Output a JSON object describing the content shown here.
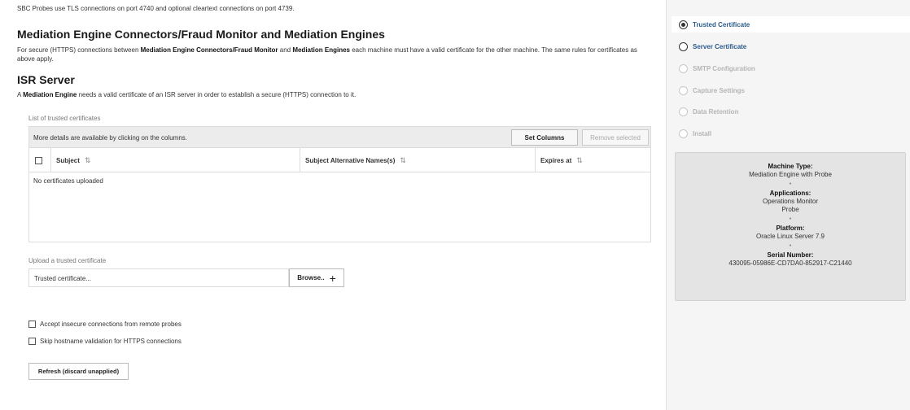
{
  "main": {
    "intro": "SBC Probes use TLS connections on port 4740 and optional cleartext connections on port 4739.",
    "section1": {
      "title": "Mediation Engine Connectors/Fraud Monitor and Mediation Engines",
      "text_1": "For secure (HTTPS) connections between ",
      "bold_1": "Mediation Engine Connectors/Fraud Monitor",
      "text_2": " and ",
      "bold_2": "Mediation Engines",
      "text_3": " each machine must have a valid certificate for the other machine. The same rules for certificates as above apply."
    },
    "section2": {
      "title": "ISR Server",
      "text_1": "A ",
      "bold_1": "Mediation Engine",
      "text_2": " needs a valid certificate of an ISR server in order to establish a secure (HTTPS) connection to it."
    },
    "trusted_list": {
      "label": "List of trusted certificates",
      "toolbar_message": "More details are available by clicking on the columns.",
      "set_columns_label": "Set Columns",
      "remove_selected_label": "Remove selected",
      "columns": [
        "Subject",
        "Subject Alternative Names(s)",
        "Expires at"
      ],
      "sort_glyph": "⇅",
      "empty_message": "No certificates uploaded"
    },
    "upload": {
      "label": "Upload a trusted certificate",
      "placeholder": "Trusted certificate...",
      "browse_label": "Browse..",
      "plus_glyph": "+"
    },
    "options": [
      {
        "label": "Accept insecure connections from remote probes",
        "checked": false
      },
      {
        "label": "Skip hostname validation for HTTPS connections",
        "checked": false
      }
    ],
    "refresh_label": "Refresh (discard unapplied)"
  },
  "sidebar": {
    "steps": [
      {
        "label": "Trusted Certificate",
        "state": "active"
      },
      {
        "label": "Server Certificate",
        "state": "enabled"
      },
      {
        "label": "SMTP Configuration",
        "state": "disabled"
      },
      {
        "label": "Capture Settings",
        "state": "disabled"
      },
      {
        "label": "Data Retention",
        "state": "disabled"
      },
      {
        "label": "Install",
        "state": "disabled"
      }
    ],
    "info": {
      "machine_type_label": "Machine Type:",
      "machine_type_value": "Mediation Engine with Probe",
      "applications_label": "Applications:",
      "applications_values": [
        "Operations Monitor",
        "Probe"
      ],
      "platform_label": "Platform:",
      "platform_value": "Oracle Linux Server 7.9",
      "serial_label": "Serial Number:",
      "serial_value": "430095-05986E-CD7DA0-852917-C21440",
      "separator": "•"
    }
  },
  "colors": {
    "link_blue": "#2a5b8c",
    "disabled_text": "#b5b5b5",
    "sidebar_bg": "#f5f5f5",
    "card_bg": "#e4e4e4"
  }
}
